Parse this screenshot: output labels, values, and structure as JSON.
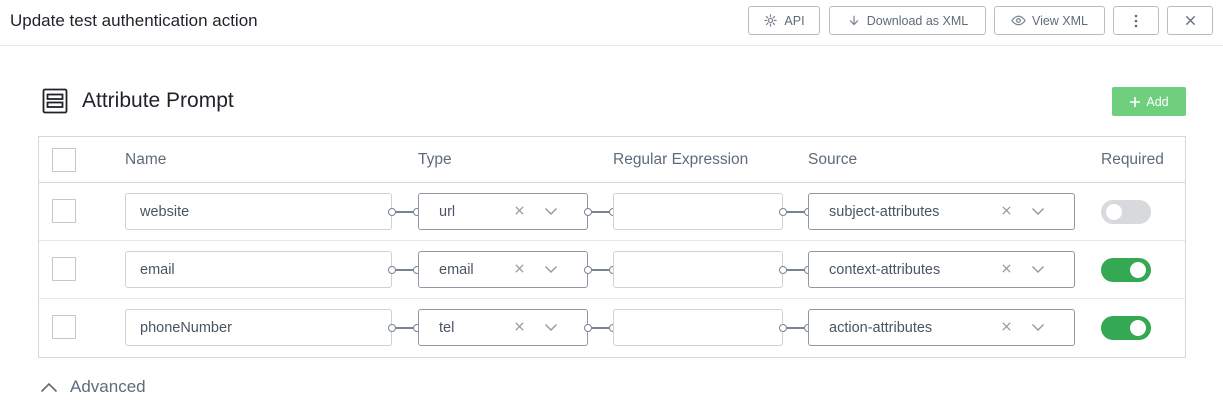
{
  "header": {
    "title": "Update test authentication action",
    "buttons": {
      "api": "API",
      "download_xml": "Download as XML",
      "view_xml": "View XML"
    }
  },
  "section": {
    "title": "Attribute Prompt",
    "add_label": "Add"
  },
  "table": {
    "columns": {
      "name": "Name",
      "type": "Type",
      "regex": "Regular Expression",
      "source": "Source",
      "required": "Required"
    },
    "rows": [
      {
        "name": "website",
        "type": "url",
        "regex": "",
        "source": "subject-attributes",
        "required": false
      },
      {
        "name": "email",
        "type": "email",
        "regex": "",
        "source": "context-attributes",
        "required": true
      },
      {
        "name": "phoneNumber",
        "type": "tel",
        "regex": "",
        "source": "action-attributes",
        "required": true
      }
    ]
  },
  "advanced": {
    "label": "Advanced",
    "expanded": true
  },
  "colors": {
    "accent": "#34a853",
    "add_button": "#6fcf7f",
    "toggle_off": "#d7d9dc"
  },
  "icons": [
    "api-icon",
    "download-icon",
    "eye-icon",
    "kebab-menu-icon",
    "close-icon",
    "form-icon",
    "plus-icon",
    "clear-icon",
    "chevron-down-icon",
    "chevron-up-icon"
  ]
}
